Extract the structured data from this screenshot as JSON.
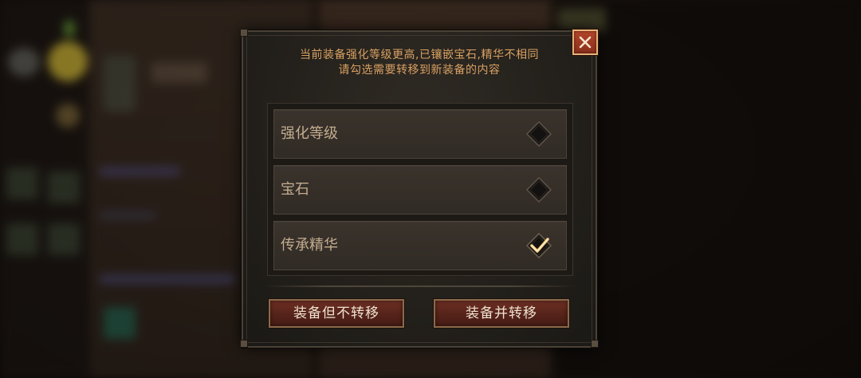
{
  "dialog": {
    "message_line1": "当前装备强化等级更高,已镶嵌宝石,精华不相同",
    "message_line2": "请勾选需要转移到新装备的内容",
    "options": [
      {
        "label": "强化等级",
        "checked": false
      },
      {
        "label": "宝石",
        "checked": false
      },
      {
        "label": "传承精华",
        "checked": true
      }
    ],
    "buttons": {
      "equip_no_transfer": "装备但不转移",
      "equip_and_transfer": "装备并转移"
    },
    "close_icon": "close-icon"
  },
  "colors": {
    "message_text": "#d8a062",
    "option_text": "#c3ad8f",
    "check_mark": "#f1c77a",
    "button_fill": "#55231a",
    "close_fill": "#a13e25"
  }
}
